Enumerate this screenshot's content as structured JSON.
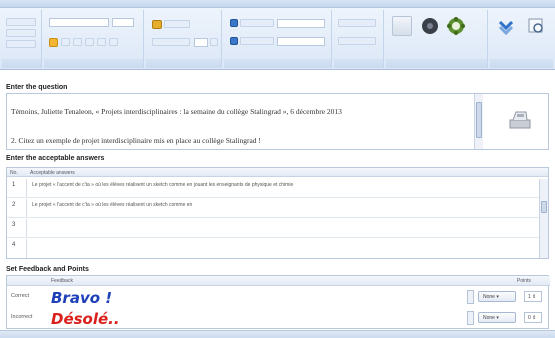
{
  "sections": {
    "question_title": "Enter the question",
    "answers_title": "Enter the acceptable answers",
    "feedback_title": "Set Feedback and Points"
  },
  "question": {
    "line1": "Témoins, Juliette Tenaleon, « Projets interdisciplinaires : la semaine du collège Stalingrad », 6 décembre 2013",
    "line2": "2. Citez un exemple de projet interdisciplinaire mis en place au collège Stalingrad !"
  },
  "answers": {
    "col_num": "No.",
    "col_answer": "Acceptable answers",
    "rows": [
      {
        "num": "1",
        "text": "Le projet « l'accent de c'ta » où les élèves réalisent un sketch comme en jouant les enseignants de physique et chimie"
      },
      {
        "num": "2",
        "text": "Le projet « l'accent de c'ta » où les élèves réalisent un sketch comme en"
      },
      {
        "num": "3",
        "text": ""
      },
      {
        "num": "4",
        "text": ""
      }
    ]
  },
  "feedback": {
    "col_feedback": "Feedback",
    "col_points": "Points",
    "correct_label": "Correct",
    "correct_text": "Bravo !",
    "correct_color": "#1d3fb8",
    "incorrect_label": "Incorrect",
    "incorrect_text": "Désolé..",
    "incorrect_color": "#d9201c",
    "none_label": "None",
    "correct_points": "1",
    "incorrect_points": "0"
  }
}
